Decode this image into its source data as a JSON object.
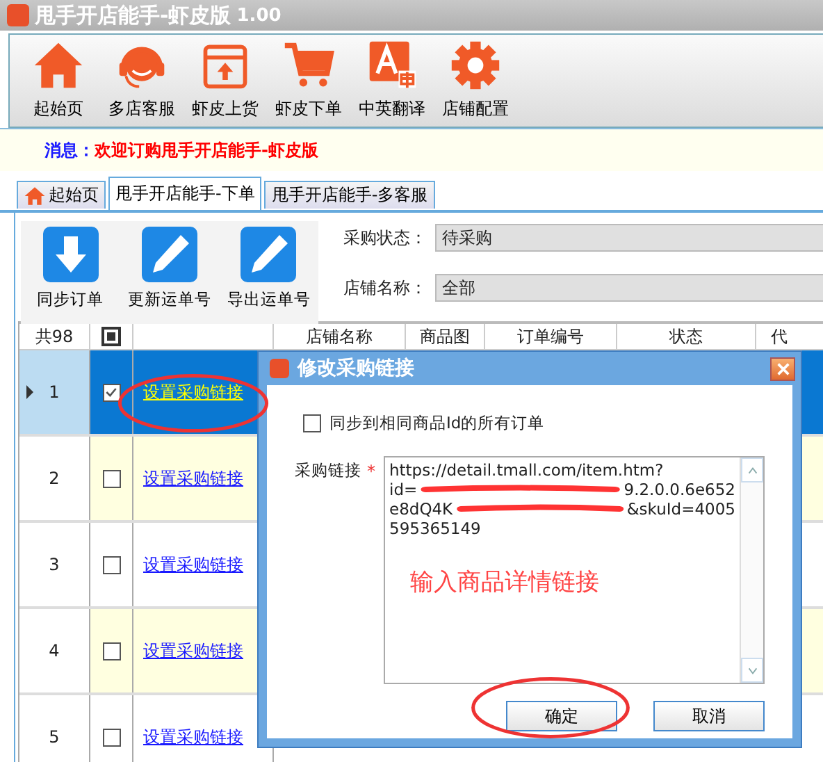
{
  "window": {
    "title": "甩手开店能手-虾皮版",
    "version": "1.00"
  },
  "toolbar": [
    {
      "label": "起始页",
      "kind": "home"
    },
    {
      "label": "多店客服",
      "kind": "headset"
    },
    {
      "label": "虾皮上货",
      "kind": "upload"
    },
    {
      "label": "虾皮下单",
      "kind": "cart"
    },
    {
      "label": "中英翻译",
      "kind": "translate"
    },
    {
      "label": "店铺配置",
      "kind": "gear"
    }
  ],
  "message": {
    "label": "消息：",
    "text": "欢迎订购甩手开店能手-虾皮版"
  },
  "tabs": [
    {
      "label": "起始页",
      "kind": "home",
      "selected": false
    },
    {
      "label": "甩手开店能手-下单",
      "kind": "plain",
      "selected": true
    },
    {
      "label": "甩手开店能手-多客服",
      "kind": "plain",
      "selected": false
    }
  ],
  "actions": [
    {
      "label": "同步订单",
      "kind": "download"
    },
    {
      "label": "更新运单号",
      "kind": "edit"
    },
    {
      "label": "导出运单号",
      "kind": "edit"
    }
  ],
  "filters": [
    {
      "label": "采购状态：",
      "value": "待采购"
    },
    {
      "label": "店铺名称：",
      "value": "全部"
    }
  ],
  "table": {
    "count": "共98",
    "select_all": {
      "indeterminate": true
    },
    "columns": [
      "店铺名称",
      "商品图",
      "订单编号",
      "状态",
      "代"
    ],
    "rows": [
      {
        "number": "1",
        "checked": true,
        "selected": true,
        "link": "设置采购链接"
      },
      {
        "number": "2",
        "checked": false,
        "selected": false,
        "link": "设置采购链接"
      },
      {
        "number": "3",
        "checked": false,
        "selected": false,
        "link": "设置采购链接"
      },
      {
        "number": "4",
        "checked": false,
        "selected": false,
        "link": "设置采购链接"
      },
      {
        "number": "5",
        "checked": false,
        "selected": false,
        "link": "设置采购链接"
      }
    ]
  },
  "dialog": {
    "title": "修改采购链接",
    "sync": {
      "label": "同步到相同商品Id的所有订单",
      "checked": false
    },
    "field_label": "采购链接",
    "required_mark": "*",
    "url_lines": [
      [
        "https://detail.tmall.com/item.htm?"
      ],
      [
        "id=",
        "9.2.0.0.6e652"
      ],
      [
        "e8dQ4K",
        "&skuId=4005"
      ],
      [
        "595365149"
      ]
    ],
    "buttons": [
      "确定",
      "取消"
    ]
  },
  "annotation": {
    "hint": "输入商品详情链接"
  }
}
